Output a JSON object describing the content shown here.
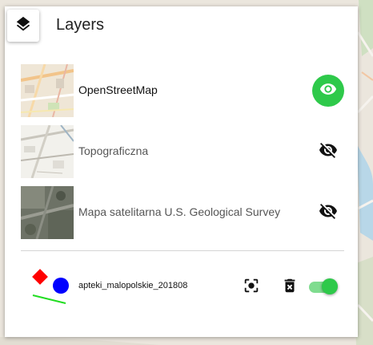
{
  "panel": {
    "title": "Layers"
  },
  "base_layers": [
    {
      "label": "OpenStreetMap",
      "visible": true,
      "thumb_icon": "osm-map-thumbnail"
    },
    {
      "label": "Topograficzna",
      "visible": false,
      "thumb_icon": "topo-map-thumbnail"
    },
    {
      "label": "Mapa satelitarna U.S. Geological Survey",
      "visible": false,
      "thumb_icon": "satellite-map-thumbnail"
    }
  ],
  "vector_layer": {
    "label": "apteki_malopolskie_201808",
    "visible": true,
    "symbols": [
      "red-diamond",
      "blue-circle",
      "green-line"
    ]
  },
  "colors": {
    "accent_green": "#2ec94a",
    "symbol_red": "#ff0000",
    "symbol_blue": "#0000ff",
    "symbol_green": "#22dd22"
  },
  "icons": {
    "layers": "layers-icon",
    "visible": "eye-icon",
    "hidden": "eye-off-icon",
    "zoom_to": "zoom-to-extent-icon",
    "delete": "delete-icon"
  }
}
